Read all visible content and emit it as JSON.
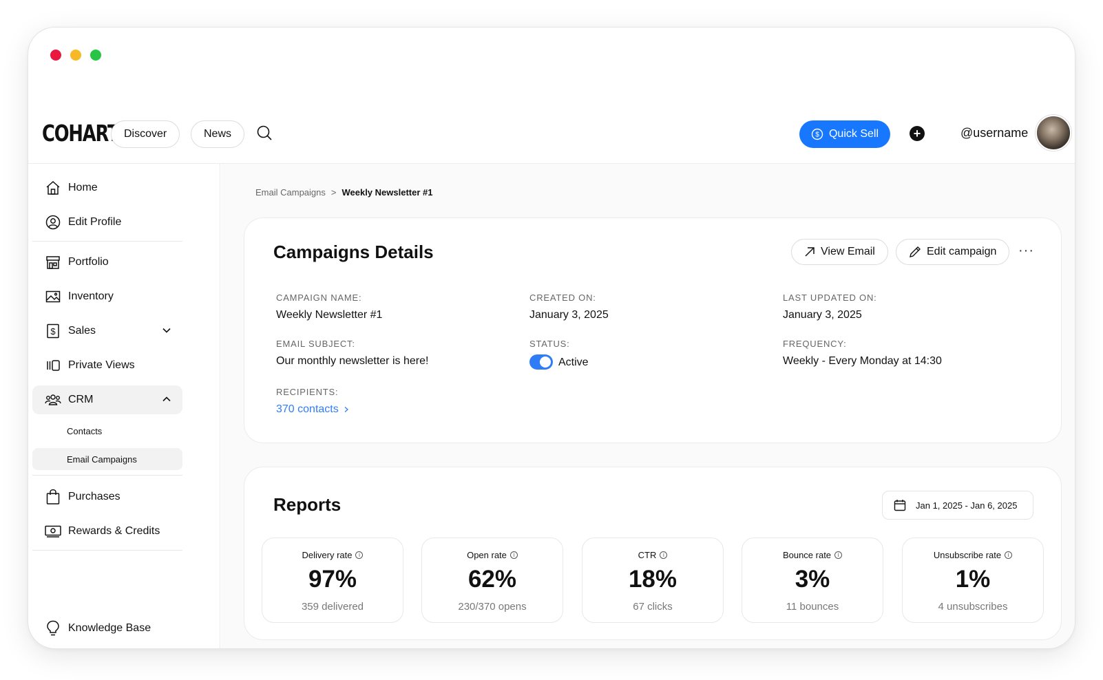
{
  "header": {
    "logo": "COHART",
    "nav": [
      {
        "label": "Discover"
      },
      {
        "label": "News"
      }
    ],
    "quick_sell_label": "Quick Sell",
    "username": "@username"
  },
  "sidebar": {
    "items": [
      {
        "label": "Home",
        "icon": "home-icon"
      },
      {
        "label": "Edit Profile",
        "icon": "user-circle-icon"
      },
      {
        "label": "Portfolio",
        "icon": "storefront-icon"
      },
      {
        "label": "Inventory",
        "icon": "image-icon"
      },
      {
        "label": "Sales",
        "icon": "dollar-icon"
      },
      {
        "label": "Private Views",
        "icon": "private-views-icon"
      },
      {
        "label": "CRM",
        "icon": "users-icon"
      },
      {
        "label": "Purchases",
        "icon": "bag-icon"
      },
      {
        "label": "Rewards & Credits",
        "icon": "cash-icon"
      },
      {
        "label": "Knowledge Base",
        "icon": "lightbulb-icon"
      }
    ],
    "crm_sub": [
      {
        "label": "Contacts"
      },
      {
        "label": "Email Campaigns"
      }
    ]
  },
  "breadcrumb": {
    "parent": "Email Campaigns",
    "separator": ">",
    "current": "Weekly Newsletter #1"
  },
  "details": {
    "title": "Campaigns Details",
    "view_email_label": "View Email",
    "edit_campaign_label": "Edit campaign",
    "more_label": "···",
    "fields": {
      "campaign_name": {
        "label": "CAMPAIGN NAME:",
        "value": "Weekly Newsletter #1"
      },
      "created_on": {
        "label": "CREATED ON:",
        "value": "January 3, 2025"
      },
      "last_updated": {
        "label": "LAST UPDATED ON:",
        "value": "January 3, 2025"
      },
      "email_subject": {
        "label": "EMAIL SUBJECT:",
        "value": "Our monthly newsletter is here!"
      },
      "status": {
        "label": "STATUS:",
        "value": "Active",
        "on": true
      },
      "frequency": {
        "label": "FREQUENCY:",
        "value": "Weekly - Every Monday at 14:30"
      },
      "recipients": {
        "label": "RECIPIENTS:",
        "value": "370 contacts"
      }
    }
  },
  "reports": {
    "title": "Reports",
    "date_range": "Jan 1, 2025 - Jan 6, 2025",
    "stats": [
      {
        "label": "Delivery rate",
        "value": "97%",
        "sub": "359 delivered"
      },
      {
        "label": "Open rate",
        "value": "62%",
        "sub": "230/370 opens"
      },
      {
        "label": "CTR",
        "value": "18%",
        "sub": "67 clicks"
      },
      {
        "label": "Bounce rate",
        "value": "3%",
        "sub": "11 bounces"
      },
      {
        "label": "Unsubscribe rate",
        "value": "1%",
        "sub": "4 unsubscribes"
      }
    ]
  },
  "colors": {
    "accent": "#1778ff",
    "link": "#2f7df6",
    "toggle_on": "#2f7df6"
  }
}
